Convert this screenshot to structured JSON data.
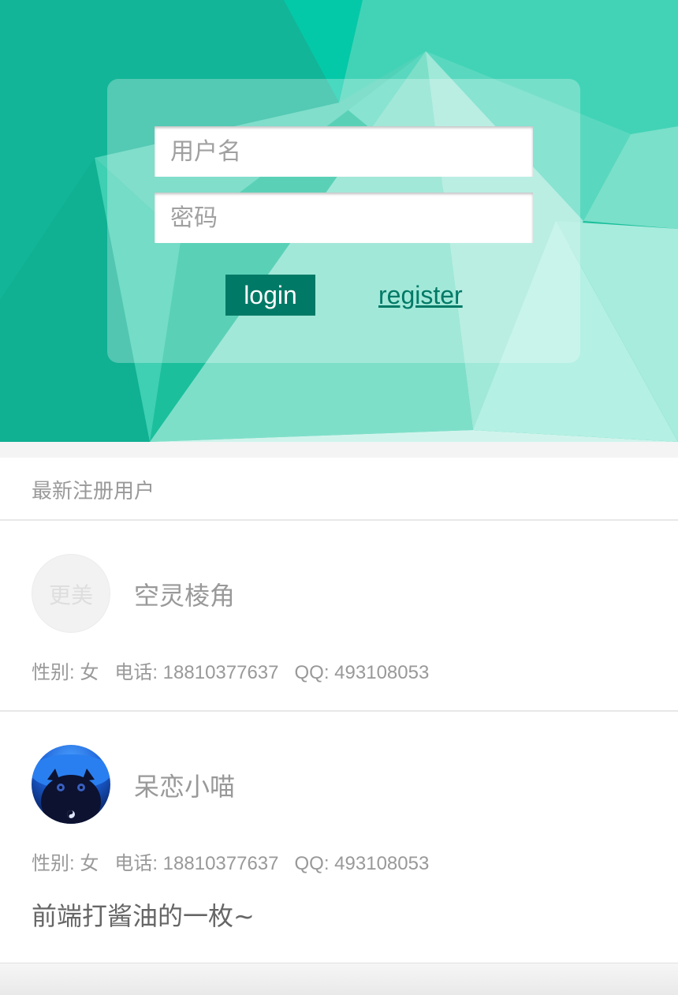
{
  "login": {
    "username_placeholder": "用户名",
    "password_placeholder": "密码",
    "login_label": "login",
    "register_label": "register"
  },
  "colors": {
    "accent": "#007966",
    "hero_bg": "#1bbf9c"
  },
  "list": {
    "title": "最新注册用户",
    "users": [
      {
        "avatar_text": "更美",
        "name": "空灵棱角",
        "info": "性别: 女   电话: 18810377637   QQ: 493108053"
      },
      {
        "avatar_icon": "cat-avatar-icon",
        "name": "呆恋小喵",
        "info": "性别: 女   电话: 18810377637   QQ: 493108053",
        "bio": "前端打酱油的一枚~"
      }
    ]
  }
}
